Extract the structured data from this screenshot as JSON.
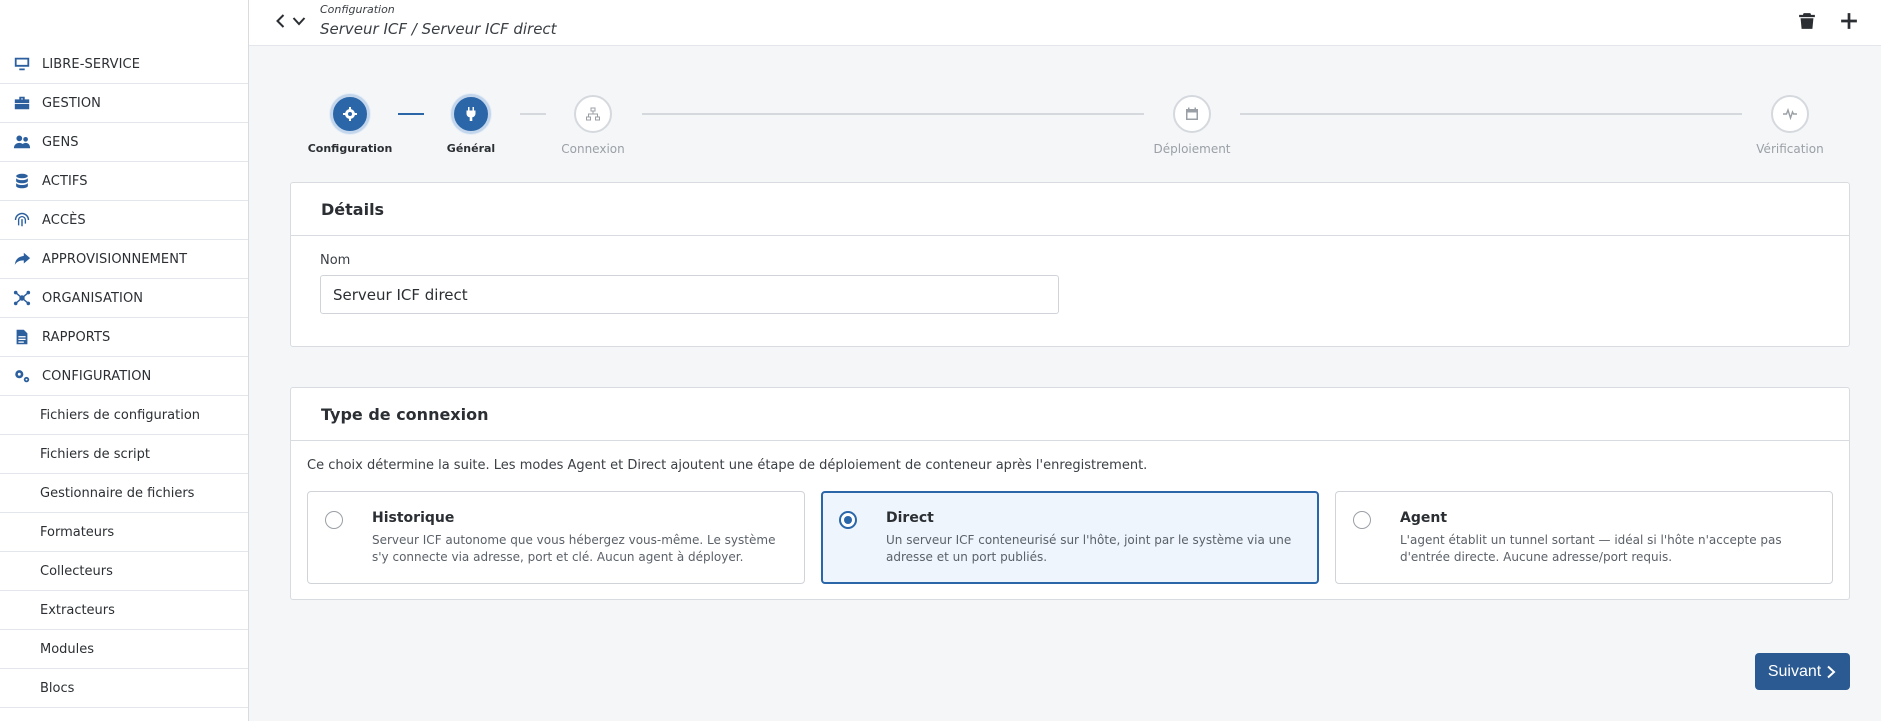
{
  "header": {
    "crumb_top": "Configuration",
    "crumb_main": "Serveur ICF / Serveur ICF direct"
  },
  "sidebar": {
    "items": [
      {
        "label": "LIBRE-SERVICE",
        "icon": "monitor-icon"
      },
      {
        "label": "GESTION",
        "icon": "toolbox-icon"
      },
      {
        "label": "GENS",
        "icon": "users-icon"
      },
      {
        "label": "ACTIFS",
        "icon": "database-icon"
      },
      {
        "label": "ACCÈS",
        "icon": "fingerprint-icon"
      },
      {
        "label": "APPROVISIONNEMENT",
        "icon": "share-icon"
      },
      {
        "label": "ORGANISATION",
        "icon": "network-icon"
      },
      {
        "label": "RAPPORTS",
        "icon": "file-icon"
      },
      {
        "label": "CONFIGURATION",
        "icon": "gears-icon"
      }
    ],
    "subitems": [
      "Fichiers de configuration",
      "Fichiers de script",
      "Gestionnaire de fichiers",
      "Formateurs",
      "Collecteurs",
      "Extracteurs",
      "Modules",
      "Blocs"
    ]
  },
  "stepper": {
    "steps": [
      {
        "label": "Configuration",
        "state": "done",
        "icon": "gear-icon"
      },
      {
        "label": "Général",
        "state": "current",
        "icon": "plug-icon"
      },
      {
        "label": "Connexion",
        "state": "future",
        "icon": "sitemap-icon"
      },
      {
        "label": "Déploiement",
        "state": "future",
        "icon": "calendar-icon"
      },
      {
        "label": "Vérification",
        "state": "future",
        "icon": "heartbeat-icon"
      }
    ]
  },
  "details": {
    "title": "Détails",
    "name_label": "Nom",
    "name_value": "Serveur ICF direct"
  },
  "connection": {
    "title": "Type de connexion",
    "description": "Ce choix détermine la suite. Les modes Agent et Direct ajoutent une étape de déploiement de conteneur après l'enregistrement.",
    "options": [
      {
        "title": "Historique",
        "text": "Serveur ICF autonome que vous hébergez vous-même. Le système s'y connecte via adresse, port et clé. Aucun agent à déployer.",
        "selected": false
      },
      {
        "title": "Direct",
        "text": "Un serveur ICF conteneurisé sur l'hôte, joint par le système via une adresse et un port publiés.",
        "selected": true
      },
      {
        "title": "Agent",
        "text": "L'agent établit un tunnel sortant — idéal si l'hôte n'accepte pas d'entrée directe. Aucune adresse/port requis.",
        "selected": false
      }
    ]
  },
  "actions": {
    "next_label": "Suivant"
  },
  "colors": {
    "accent": "#2b66a8",
    "button": "#2b5a92",
    "selected_bg": "#eef5fc"
  }
}
